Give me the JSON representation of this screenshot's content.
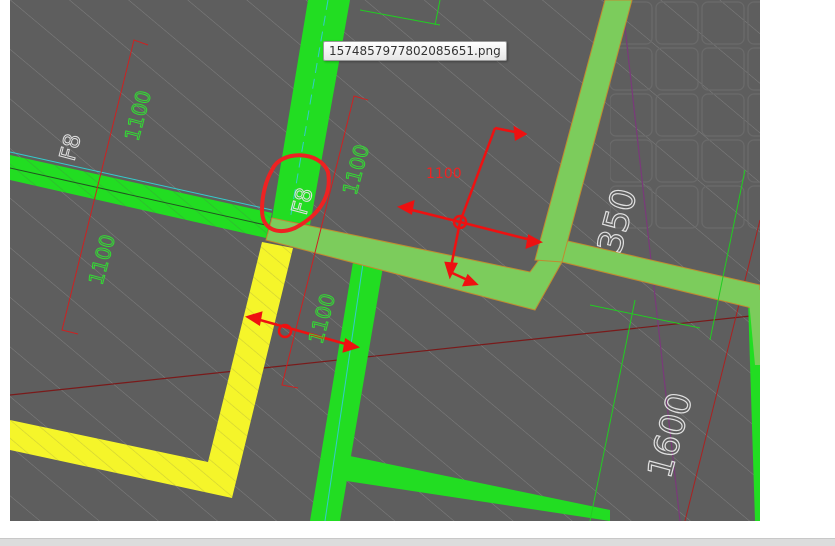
{
  "tooltip": {
    "filename": "1574857977802085651.png"
  },
  "drawing": {
    "labels": {
      "f8_top": "F8",
      "f8_mid": "F8",
      "dim_1100_a": "1100",
      "dim_1100_b": "1100",
      "dim_1100_c": "1100",
      "dim_1100_d": "1100",
      "dim_1100_red": "1100",
      "dim_350": "350",
      "dim_1600": "1600"
    },
    "colors": {
      "background": "#5e5e5e",
      "green_beam": "#22dd22",
      "light_green_beam": "#7ccc5c",
      "yellow_beam": "#f5f52a",
      "red_marker": "#ee1111",
      "dim_line_red": "#cc2222",
      "hatch": "#8a8a8a"
    }
  }
}
